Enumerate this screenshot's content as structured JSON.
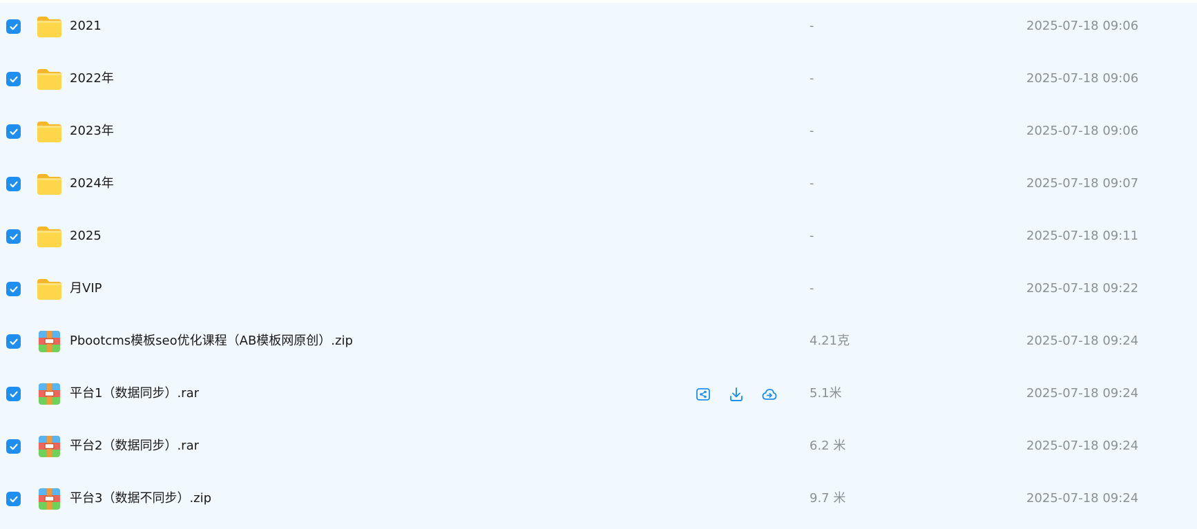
{
  "accent_color": "#1f8ef1",
  "row_actions": [
    {
      "name": "share-icon"
    },
    {
      "name": "download-icon"
    },
    {
      "name": "cloud-save-icon"
    }
  ],
  "files": [
    {
      "name": "2021",
      "type": "folder",
      "size": "-",
      "date": "2025-07-18 09:06",
      "checked": true
    },
    {
      "name": "2022年",
      "type": "folder",
      "size": "-",
      "date": "2025-07-18 09:06",
      "checked": true
    },
    {
      "name": "2023年",
      "type": "folder",
      "size": "-",
      "date": "2025-07-18 09:06",
      "checked": true
    },
    {
      "name": "2024年",
      "type": "folder",
      "size": "-",
      "date": "2025-07-18 09:07",
      "checked": true
    },
    {
      "name": "2025",
      "type": "folder",
      "size": "-",
      "date": "2025-07-18 09:11",
      "checked": true
    },
    {
      "name": "月VIP",
      "type": "folder",
      "size": "-",
      "date": "2025-07-18 09:22",
      "checked": true
    },
    {
      "name": "Pbootcms模板seo优化课程（AB模板网原创）.zip",
      "type": "archive",
      "size": "4.21克",
      "date": "2025-07-18 09:24",
      "checked": true
    },
    {
      "name": "平台1（数据同步）.rar",
      "type": "archive",
      "size": "5.1米",
      "date": "2025-07-18 09:24",
      "checked": true,
      "hovered": true
    },
    {
      "name": "平台2（数据同步）.rar",
      "type": "archive",
      "size": "6.2 米",
      "date": "2025-07-18 09:24",
      "checked": true
    },
    {
      "name": "平台3（数据不同步）.zip",
      "type": "archive",
      "size": "9.7 米",
      "date": "2025-07-18 09:24",
      "checked": true
    }
  ]
}
